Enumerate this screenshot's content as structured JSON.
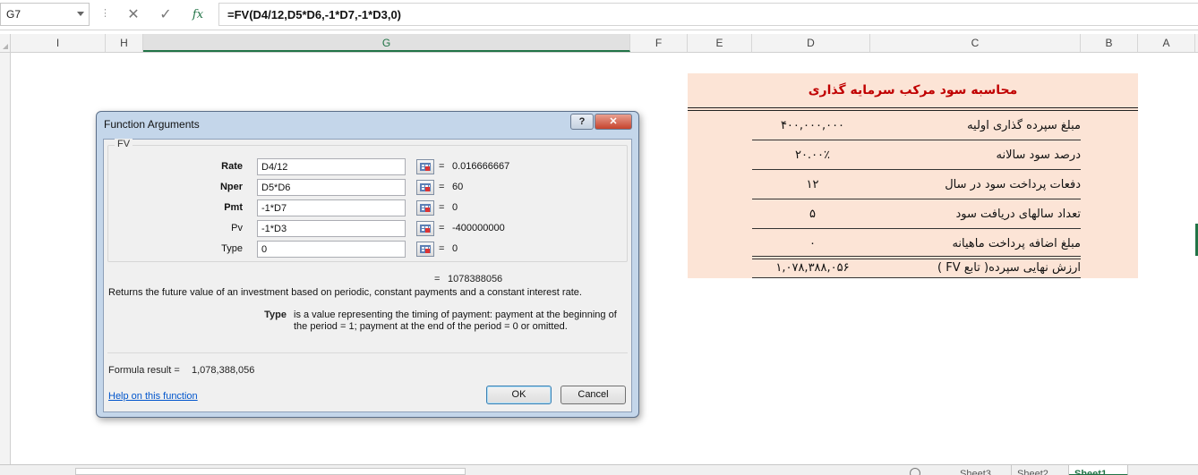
{
  "formula_bar": {
    "name_box": "G7",
    "cancel_icon": "close-icon",
    "enter_icon": "check-icon",
    "insert_function_label": "fx",
    "formula": "=FV(D4/12,D5*D6,-1*D7,-1*D3,0)"
  },
  "columns": [
    "I",
    "H",
    "G",
    "F",
    "E",
    "D",
    "C",
    "B",
    "A"
  ],
  "selected_column": "G",
  "table": {
    "title": "محاسبه سود مرکب سرمایه گذاری",
    "rows": [
      {
        "label": "مبلغ سپرده گذاری اولیه",
        "value": "۴۰۰,۰۰۰,۰۰۰"
      },
      {
        "label": "درصد سود سالانه",
        "value": "۲۰.۰۰٪"
      },
      {
        "label": "دفعات پرداخت سود در سال",
        "value": "۱۲"
      },
      {
        "label": "تعداد سالهای دریافت سود",
        "value": "۵"
      },
      {
        "label": "مبلغ اضافه پرداخت ماهیانه",
        "value": "۰"
      }
    ],
    "final": {
      "label": "ارزش نهایی سپرده( تابع FV )",
      "value": "۱,۰۷۸,۳۸۸,۰۵۶"
    }
  },
  "dialog": {
    "title": "Function Arguments",
    "help_button": "?",
    "close_icon": "close-icon",
    "function_name": "FV",
    "arguments": [
      {
        "name": "Rate",
        "input": "D4/12",
        "eq": "=",
        "result": "0.016666667",
        "bold": true
      },
      {
        "name": "Nper",
        "input": "D5*D6",
        "eq": "=",
        "result": "60",
        "bold": true
      },
      {
        "name": "Pmt",
        "input": "-1*D7",
        "eq": "=",
        "result": "0",
        "bold": true
      },
      {
        "name": "Pv",
        "input": "-1*D3",
        "eq": "=",
        "result": "-400000000",
        "bold": false
      },
      {
        "name": "Type",
        "input": "0",
        "eq": "=",
        "result": "0",
        "bold": false
      }
    ],
    "result_eq": "=",
    "result_value": "1078388056",
    "description": "Returns the future value of an investment based on periodic, constant payments and a constant interest rate.",
    "arg_help_name": "Type",
    "arg_help_text": "is a value representing the timing of payment: payment at the beginning of the period = 1; payment at the end of the period = 0 or omitted.",
    "formula_result_label": "Formula result =",
    "formula_result_value": "1,078,388,056",
    "help_link": "Help on this function",
    "ok": "OK",
    "cancel": "Cancel"
  },
  "sheet_tabs": [
    "Sheet3",
    "Sheet2",
    "Sheet1"
  ],
  "active_sheet": "Sheet1",
  "colors": {
    "accent": "#217346",
    "table_fill": "#fce4d6",
    "title_red": "#c00000",
    "link": "#0055cc"
  }
}
